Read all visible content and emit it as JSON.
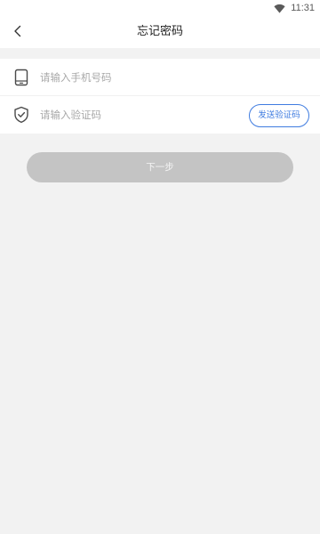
{
  "status_bar": {
    "time": "11:31",
    "icons": [
      "wifi-icon"
    ]
  },
  "header": {
    "title": "忘记密码",
    "back_icon": "back-chevron-icon"
  },
  "form": {
    "phone": {
      "icon": "mobile-phone-icon",
      "placeholder": "请输入手机号码",
      "value": ""
    },
    "verification_code": {
      "icon": "shield-check-icon",
      "placeholder": "请输入验证码",
      "value": "",
      "send_button_label": "发送验证码"
    }
  },
  "actions": {
    "next_label": "下一步"
  },
  "colors": {
    "accent": "#3f7ce0",
    "page_background": "#f2f2f2",
    "disabled_button": "#c4c4c4"
  }
}
